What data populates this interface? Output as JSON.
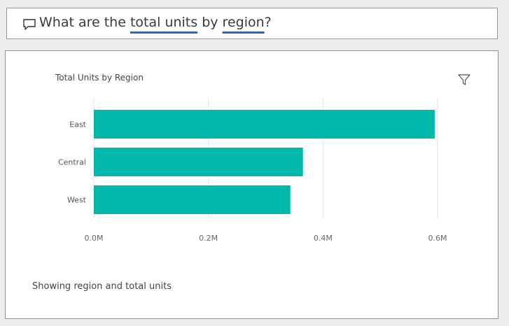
{
  "qa": {
    "prefix": "What are the ",
    "keyword1": "total units",
    "middle": " by ",
    "keyword2": "region",
    "suffix": "?"
  },
  "visual": {
    "status_text": "Showing region and total units"
  },
  "icons": {
    "qa": "speech-bubble-icon",
    "filter": "filter-icon"
  },
  "colors": {
    "bar": "#01b8aa",
    "keyword_underline": "#1e6fbf"
  },
  "chart_data": {
    "type": "bar",
    "orientation": "horizontal",
    "title": "Total Units by Region",
    "categories": [
      "East",
      "Central",
      "West"
    ],
    "values": [
      0.595,
      0.365,
      0.343
    ],
    "value_unit": "M",
    "xlim": [
      0,
      0.6
    ],
    "xticks": [
      "0.0M",
      "0.2M",
      "0.4M",
      "0.6M"
    ],
    "grid": true,
    "legend": "none"
  }
}
